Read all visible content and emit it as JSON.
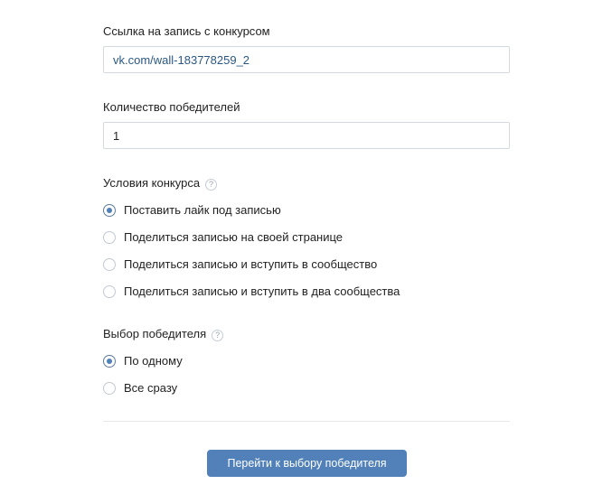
{
  "link_section": {
    "label": "Ссылка на запись с конкурсом",
    "value": "vk.com/wall-183778259_2"
  },
  "winners_section": {
    "label": "Количество победителей",
    "value": "1"
  },
  "conditions": {
    "label": "Условия конкурса",
    "help_icon": "?",
    "options": [
      {
        "label": "Поставить лайк под записью",
        "selected": true
      },
      {
        "label": "Поделиться записью на своей странице",
        "selected": false
      },
      {
        "label": "Поделиться записью и вступить в сообщество",
        "selected": false
      },
      {
        "label": "Поделиться записью и вступить в два сообщества",
        "selected": false
      }
    ]
  },
  "winner_choice": {
    "label": "Выбор победителя",
    "help_icon": "?",
    "options": [
      {
        "label": "По одному",
        "selected": true
      },
      {
        "label": "Все сразу",
        "selected": false
      }
    ]
  },
  "submit_button": {
    "label": "Перейти к выбору победителя"
  },
  "colors": {
    "accent": "#5181b8",
    "link_text": "#2a5885",
    "border": "#d3d9de"
  }
}
